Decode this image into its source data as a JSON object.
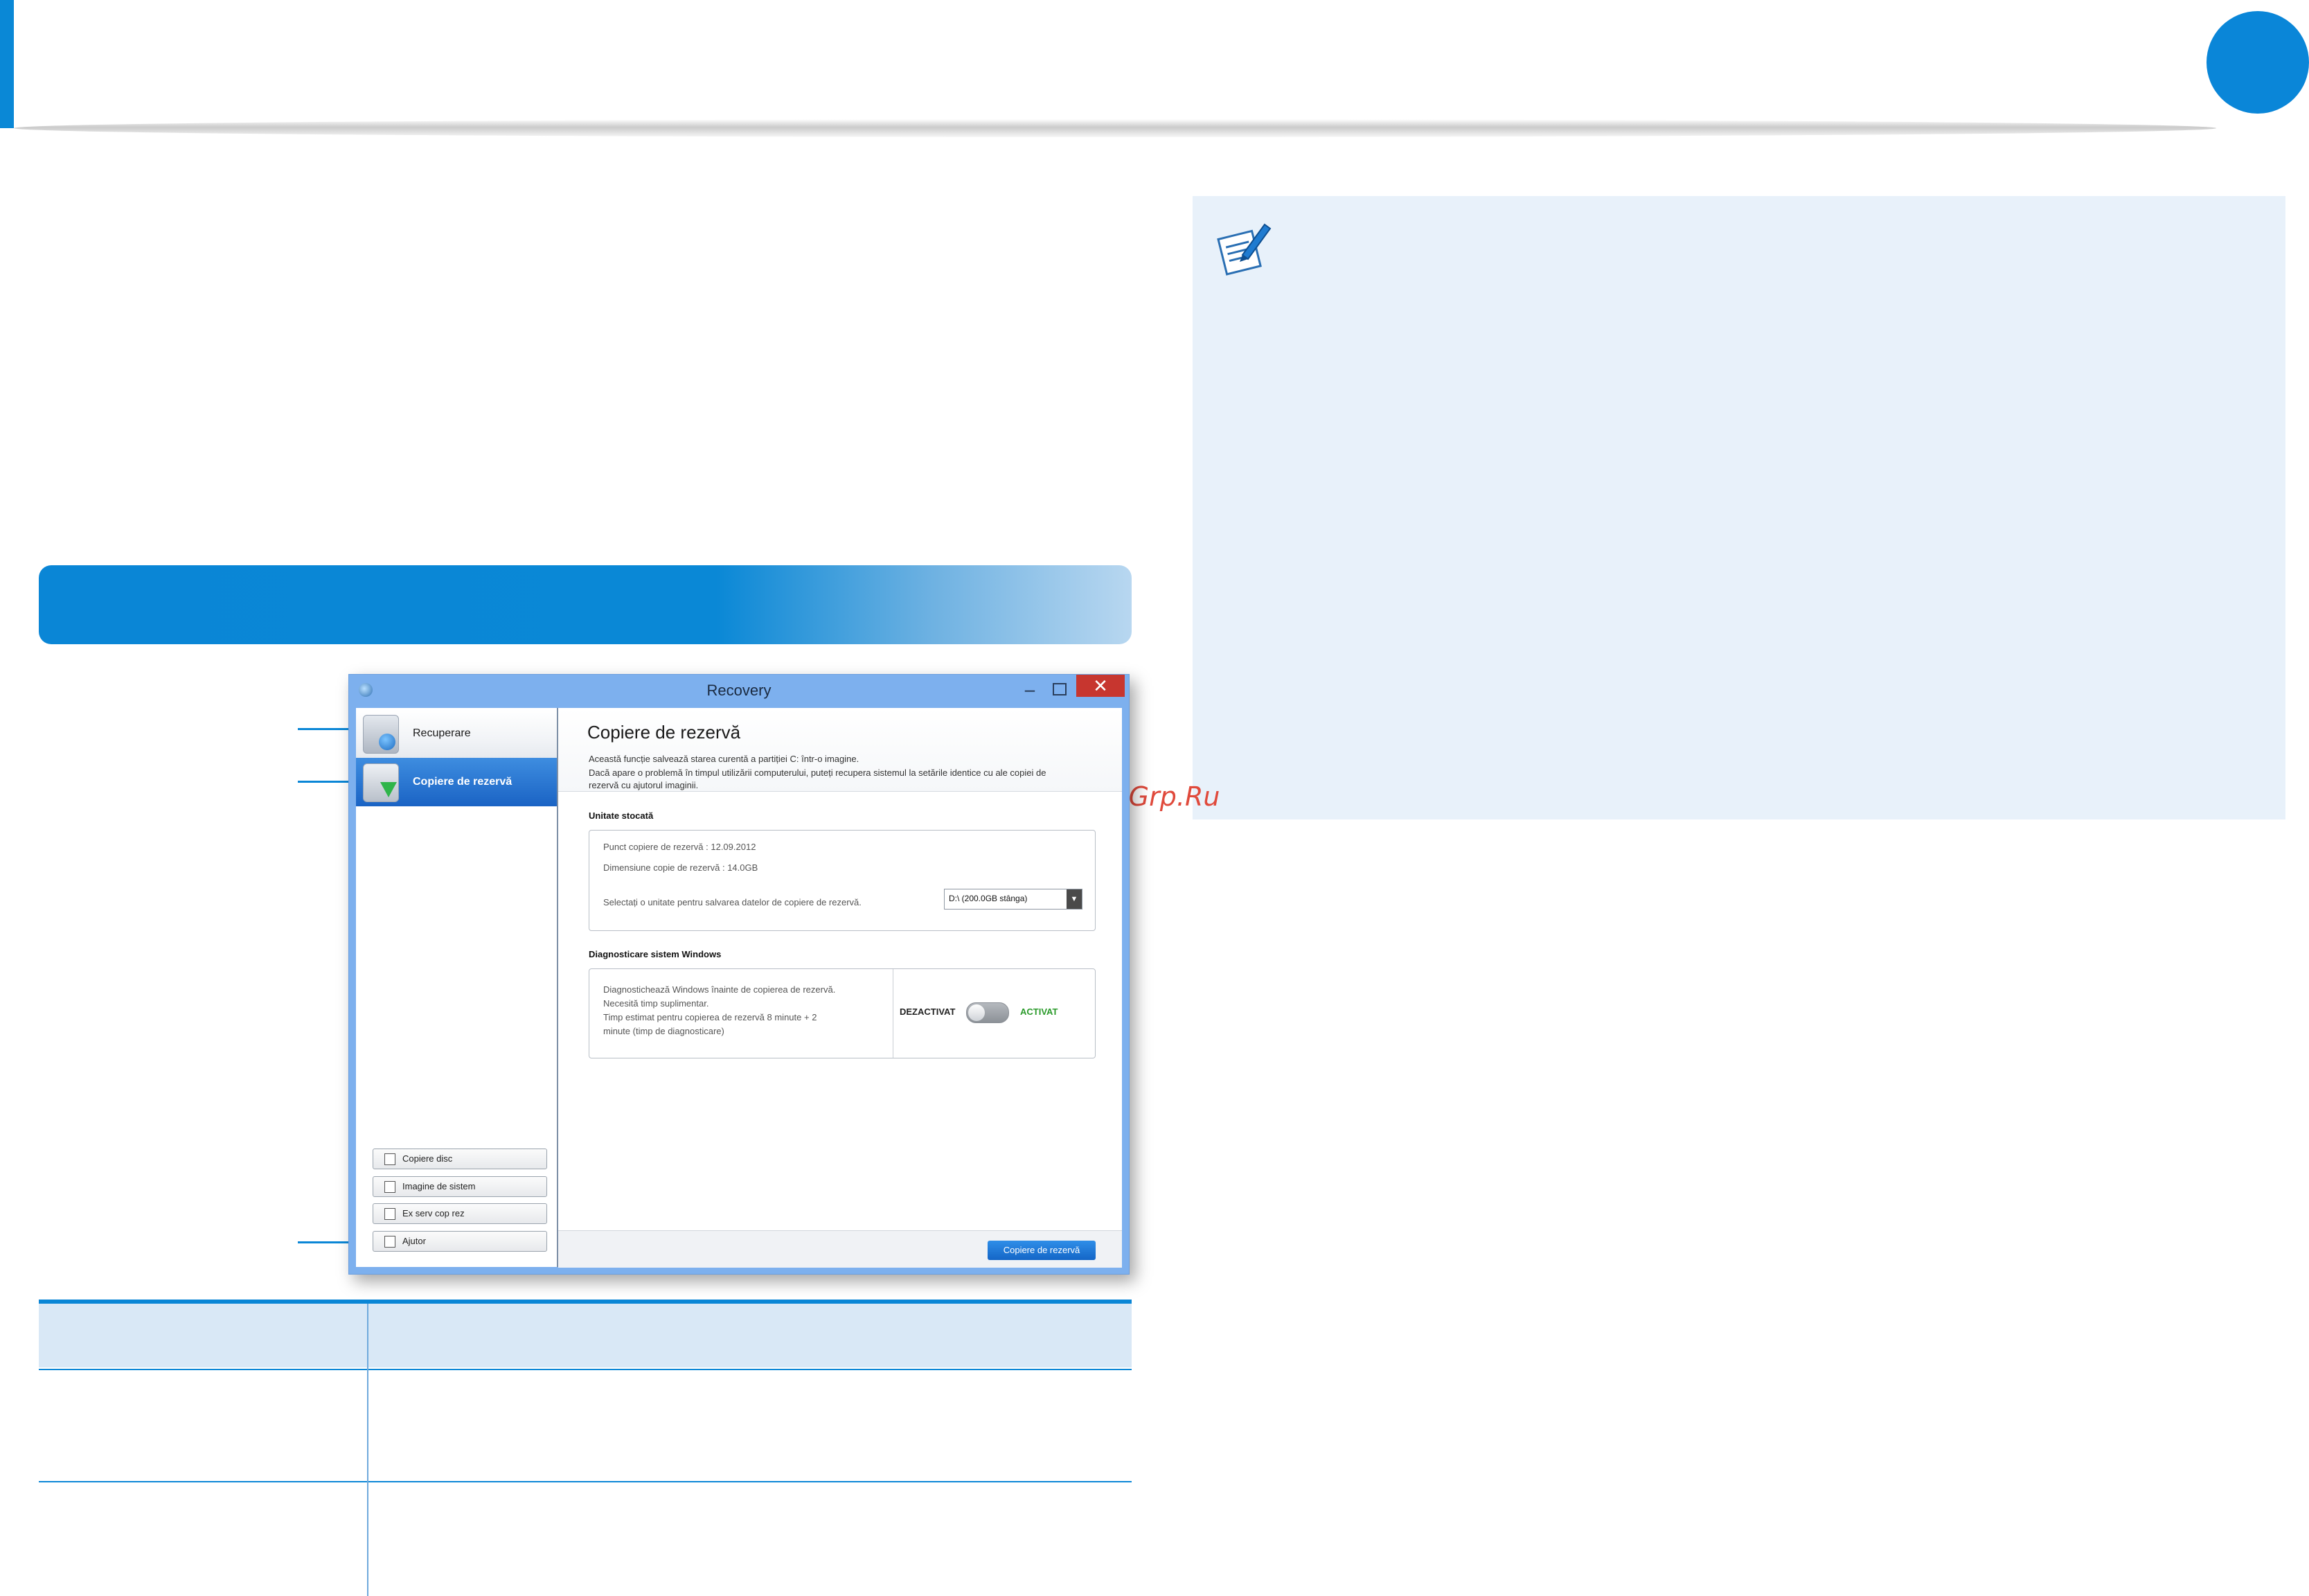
{
  "window": {
    "title": "Recovery",
    "controls": {
      "minimize": "–",
      "close": "✕"
    }
  },
  "sidebar": {
    "items": [
      {
        "label": "Recuperare",
        "icon": "restore-icon",
        "selected": false
      },
      {
        "label": "Copiere de rezervă",
        "icon": "backup-icon",
        "selected": true
      }
    ],
    "buttons": [
      {
        "label": "Copiere disc",
        "icon": "disc-copy-icon"
      },
      {
        "label": "Imagine de sistem",
        "icon": "system-image-icon"
      },
      {
        "label": "Ex serv cop rez",
        "icon": "export-icon"
      },
      {
        "label": "Ajutor",
        "icon": "help-icon"
      }
    ]
  },
  "main": {
    "title": "Copiere de rezervă",
    "description": [
      "Această funcție salvează starea curentă a partiției C: într-o imagine.",
      "Dacă apare o problemă în timpul utilizării computerului, puteți recupera sistemul la setările identice cu ale copiei de",
      "rezervă cu ajutorul imaginii."
    ],
    "storage": {
      "title": "Unitate stocată",
      "backup_point": "Punct copiere de rezervă : 12.09.2012",
      "backup_size": "Dimensiune copie de rezervă : 14.0GB",
      "select_prompt": "Selectați o unitate pentru salvarea datelor de copiere de rezervă.",
      "drive_value": "D:\\ (200.0GB stânga)",
      "drive_arrow": "▼"
    },
    "diagnostics": {
      "title": "Diagnosticare sistem Windows",
      "text": [
        "Diagnostichează Windows înainte de copierea de rezervă.",
        "Necesită timp suplimentar.",
        "Timp estimat pentru copierea de rezervă 8 minute + 2",
        "minute (timp de diagnosticare)"
      ],
      "off_label": "DEZACTIVAT",
      "on_label": "ACTIVAT",
      "toggle_state": "off"
    },
    "action_button": "Copiere de rezervă"
  },
  "page": {
    "watermark": "McGrp.Ru",
    "accent_color": "#0a86d6",
    "note_bg_color": "#e8f1fa",
    "note_icon": "note-pencil-icon"
  }
}
